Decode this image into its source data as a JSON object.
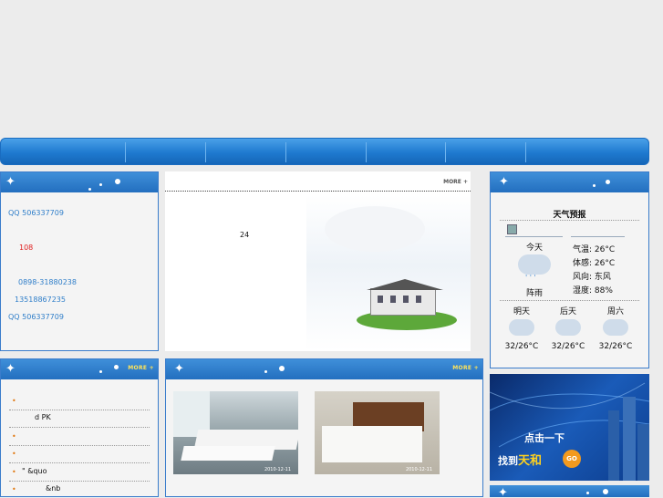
{
  "nav": {
    "items": [
      "",
      "",
      "",
      "",
      "",
      "",
      "",
      ""
    ]
  },
  "contact": {
    "qq1": "QQ 506337709",
    "rooms": "108",
    "phone": "0898-31880238",
    "mobile": "13518867235",
    "qq2": "QQ 506337709"
  },
  "center": {
    "more_label": "MORE +",
    "number": "24"
  },
  "weather": {
    "title": "天气预报",
    "today": {
      "day_label": "今天",
      "condition": "阵雨",
      "rows": [
        {
          "label": "气温",
          "value": "26°C"
        },
        {
          "label": "体感",
          "value": "26°C"
        },
        {
          "label": "风向",
          "value": "东风"
        },
        {
          "label": "湿度",
          "value": "88%"
        }
      ]
    },
    "forecast": [
      {
        "day": "明天",
        "temp": "32/26°C"
      },
      {
        "day": "后天",
        "temp": "32/26°C"
      },
      {
        "day": "周六",
        "temp": "32/26°C"
      }
    ]
  },
  "news": {
    "more_label": "MORE +",
    "items": [
      "",
      "d PK",
      "",
      "",
      "\"    &quo",
      "&nb"
    ]
  },
  "photos": {
    "more_label": "MORE +",
    "items": [
      {
        "date": "2010-12-11"
      },
      {
        "date": "2010-12-11"
      }
    ]
  },
  "banner": {
    "line1": "点击一下",
    "line2_prefix": "找到",
    "line2_brand": "天和",
    "go": "GO"
  },
  "colors": {
    "nav": "#1f7ad0",
    "header": "#2b77c6",
    "link": "#2f7ec9",
    "accent": "#e02020",
    "bullet": "#e07810"
  }
}
